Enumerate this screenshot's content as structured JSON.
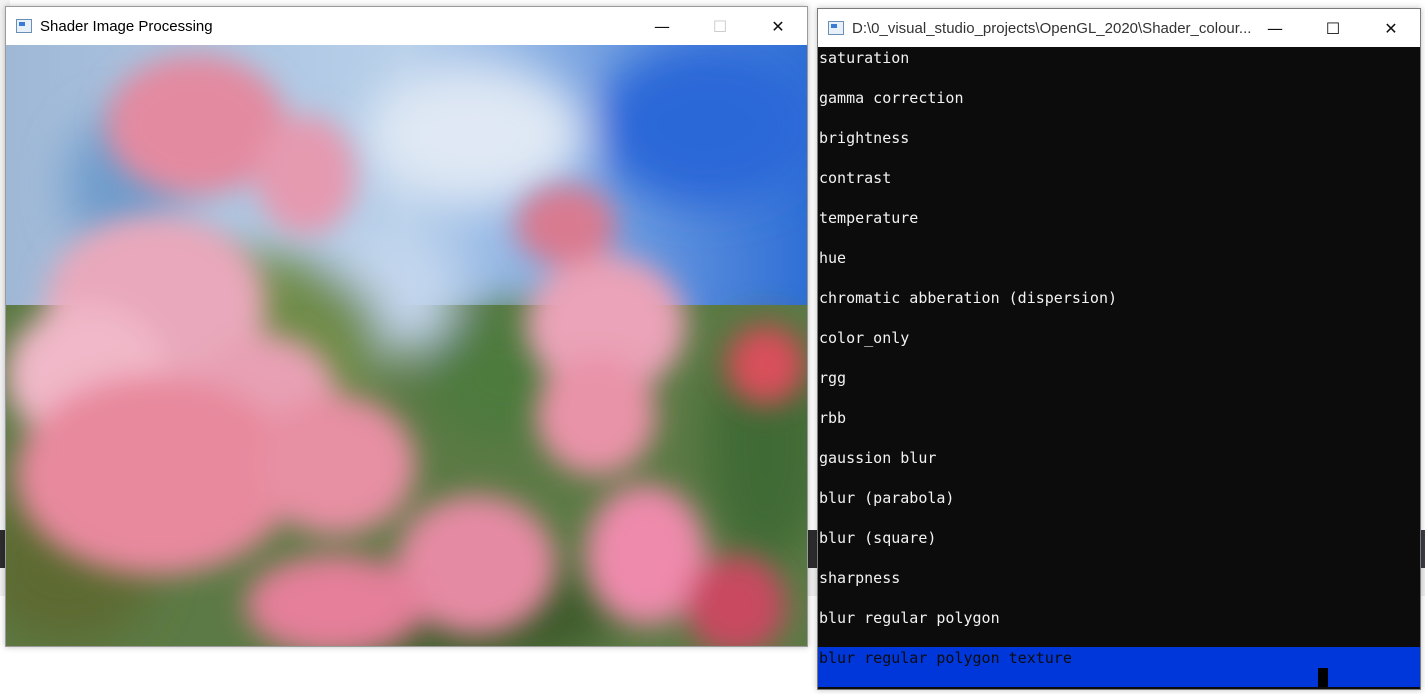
{
  "background_ide": {
    "colors": {
      "dark_bar": "#2d2d30",
      "light_bar": "#f0f0f0"
    }
  },
  "image_window": {
    "title": "Shader Image Processing",
    "icon": "app-window-icon",
    "controls": {
      "minimize": "—",
      "maximize": "☐",
      "close": "✕"
    },
    "image": "blurred pink roses against blue sky"
  },
  "console_window": {
    "title": "D:\\0_visual_studio_projects\\OpenGL_2020\\Shader_colour...",
    "icon": "console-window-icon",
    "controls": {
      "minimize": "—",
      "maximize": "☐",
      "close": "✕"
    },
    "lines": [
      "saturation",
      "gamma correction",
      "brightness",
      "contrast",
      "temperature",
      "hue",
      "chromatic abberation (dispersion)",
      "color_only",
      "rgg",
      "rbb",
      "gaussion blur",
      "blur (parabola)",
      "blur (square)",
      "sharpness",
      "blur regular polygon",
      "blur regular polygon texture"
    ],
    "selected_index": 15,
    "colors": {
      "background": "#0c0c0c",
      "text": "#f2f2f2",
      "selection": "#0037da"
    }
  }
}
